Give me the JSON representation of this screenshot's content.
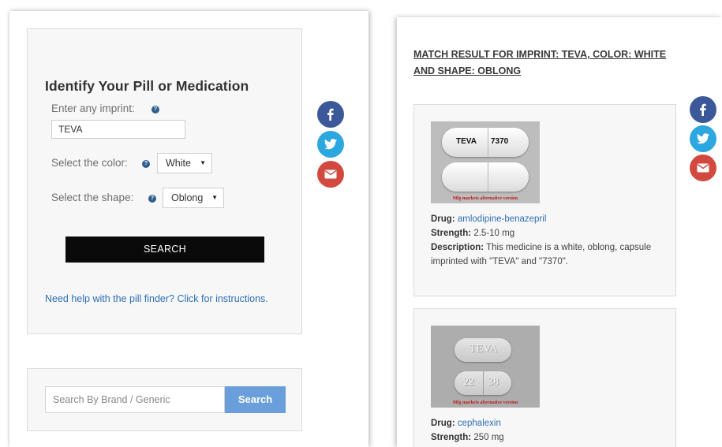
{
  "finder": {
    "title": "Identify Your Pill or Medication",
    "imprint_label": "Enter any imprint:",
    "imprint_value": "TEVA",
    "color_label": "Select the color:",
    "color_value": "White",
    "shape_label": "Select the shape:",
    "shape_value": "Oblong",
    "search_label": "SEARCH",
    "help_link": "Need help with the pill finder? Click for instructions.",
    "help_icon": "question-circle-icon"
  },
  "brand_search": {
    "placeholder": "Search By Brand / Generic",
    "button_label": "Search"
  },
  "social": {
    "icons": [
      "facebook-icon",
      "twitter-icon",
      "email-icon"
    ],
    "colors": {
      "facebook": "#3b5998",
      "twitter": "#2ca7e0",
      "email": "#d24a3f"
    }
  },
  "results": {
    "title": "MATCH RESULT FOR IMPRINT: TEVA, COLOR: WHITE AND SHAPE: OBLONG",
    "items": [
      {
        "image_imprint_1": "TEVA",
        "image_imprint_2": "7370",
        "watermark": "Mfg markets alternative version",
        "drug_label": "Drug:",
        "drug": "amlodipine-benazepril",
        "strength_label": "Strength:",
        "strength": "2.5-10 mg",
        "description_label": "Description:",
        "description": "This medicine is a white, oblong, capsule imprinted with \"TEVA\" and \"7370\"."
      },
      {
        "image_imprint_1": "TEVA",
        "image_imprint_2a": "22",
        "image_imprint_2b": "38",
        "watermark": "Mfg markets alternative version",
        "drug_label": "Drug:",
        "drug": "cephalexin",
        "strength_label": "Strength:",
        "strength": "250 mg"
      }
    ]
  }
}
